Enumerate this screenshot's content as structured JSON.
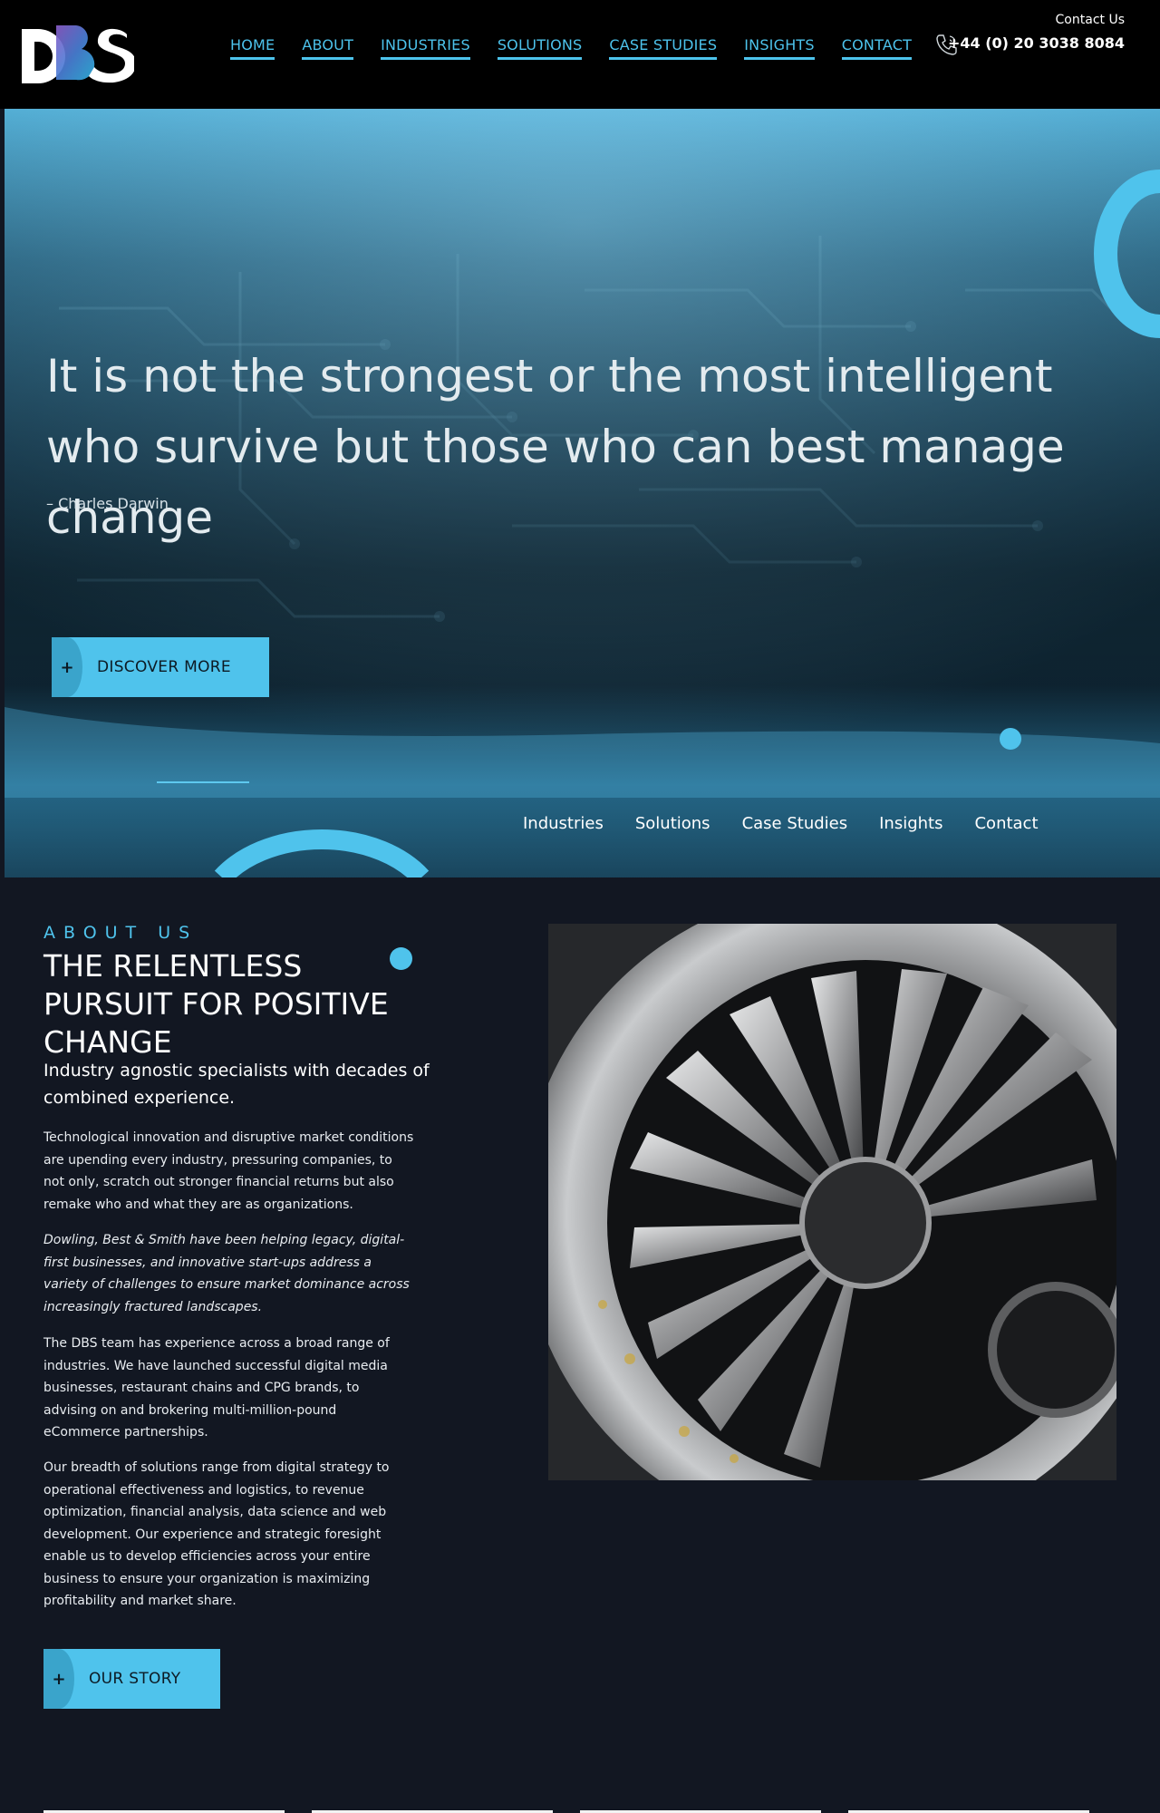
{
  "brand": {
    "logo_text": "DBS"
  },
  "header": {
    "nav": [
      "HOME",
      "ABOUT",
      "INDUSTRIES",
      "SOLUTIONS",
      "CASE STUDIES",
      "INSIGHTS",
      "CONTACT"
    ],
    "contact_label": "Contact Us",
    "contact_phone": "+44 (0) 20 3038 8084"
  },
  "hero": {
    "quote": "It is not the strongest or the most intelligent who survive but those who can best manage change",
    "author": "– Charles Darwin",
    "cta_label": "DISCOVER MORE",
    "links": [
      "Industries",
      "Solutions",
      "Case Studies",
      "Insights",
      "Contact"
    ]
  },
  "about": {
    "eyebrow": "ABOUT US",
    "title": "THE RELENTLESS PURSUIT FOR POSITIVE CHANGE",
    "lead": "Industry agnostic specialists with decades of combined experience.",
    "paragraphs": [
      "Technological innovation and disruptive market conditions are upending every industry, pressuring companies, to not only, scratch out stronger financial returns but also remake who and what they are as organizations.",
      "Dowling, Best & Smith have been helping legacy, digital-first businesses, and innovative start-ups address a variety of challenges to ensure market dominance across increasingly fractured landscapes.",
      "The DBS team has experience across a broad range of industries. We have launched successful digital media businesses, restaurant chains and CPG brands, to advising on and brokering multi-million-pound eCommerce partnerships.",
      "Our breadth of solutions range from digital strategy to operational effectiveness and logistics, to revenue optimization, financial analysis, data science and web development. Our experience and strategic foresight enable us to develop efficiencies across your entire business to ensure your organization is maximizing profitability and market share."
    ],
    "cta_label": "OUR STORY",
    "plus_symbol": "+"
  },
  "colors": {
    "accent": "#4fc3ec",
    "header_bg": "#000000",
    "page_bg": "#121722"
  },
  "icons": {
    "phone": "phone-icon",
    "plus": "plus-icon"
  }
}
